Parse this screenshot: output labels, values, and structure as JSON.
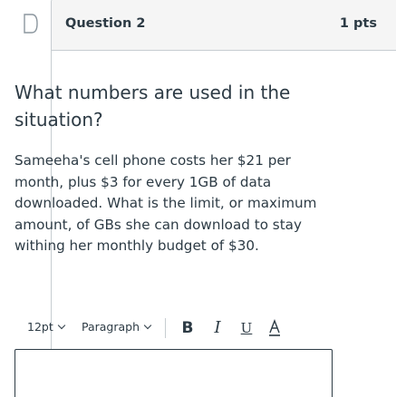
{
  "question": {
    "title": "Question 2",
    "points": "1 pts",
    "heading": "What numbers are used in the situation?",
    "body": "Sameeha's cell phone costs her $21 per month, plus $3 for every 1GB of data downloaded. What is the limit, or maximum amount, of GBs she can download to stay withing her monthly budget of $30."
  },
  "toolbar": {
    "font_size": "12pt",
    "block_format": "Paragraph",
    "icons": [
      "bold-icon",
      "italic-icon",
      "underline-icon",
      "text-color-icon"
    ]
  },
  "colors": {
    "text": "#2d3b45",
    "header_bg": "#f5f5f5",
    "border": "#c7cdd1"
  }
}
